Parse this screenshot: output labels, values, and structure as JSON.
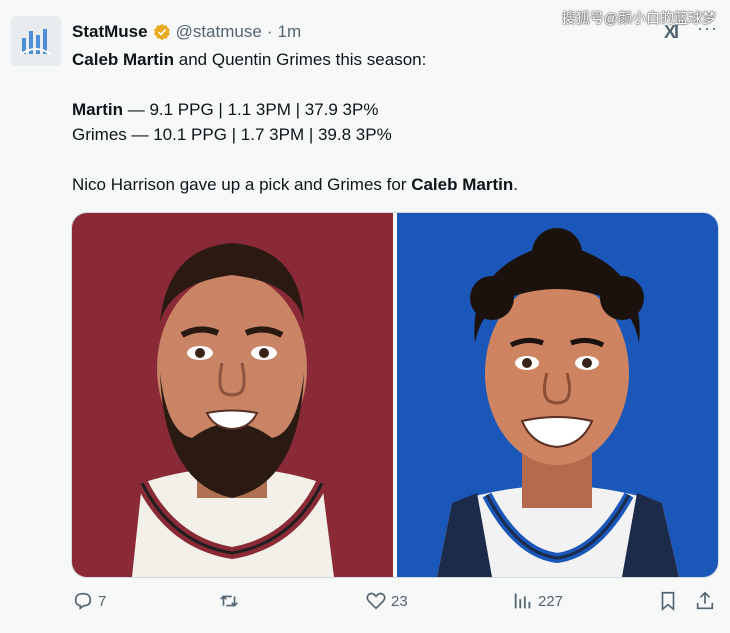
{
  "tweet": {
    "display_name": "StatMuse",
    "handle": "@statmuse",
    "separator": "·",
    "time": "1m",
    "lines": {
      "line1_bold": "Caleb Martin",
      "line1_rest": " and Quentin Grimes this season:",
      "martin_label": "Martin",
      "martin_stats": " — 9.1 PPG | 1.1 3PM | 37.9 3P%",
      "grimes_stats": "Grimes — 10.1 PPG | 1.7 3PM | 39.8 3P%",
      "line4_rest": "Nico Harrison gave up a pick and Grimes for ",
      "line4_bold": "Caleb Martin",
      "line4_end": "."
    }
  },
  "watermark": "搜狐号@颜小白的篮球梦",
  "grok_label": "XI",
  "more_label": "···",
  "actions": {
    "replies": "7",
    "likes": "23",
    "views": "227"
  },
  "colors": {
    "left_panel": "#8a2a37",
    "right_panel": "#1a57b8",
    "verified": "#e8a91c",
    "text_secondary": "#536471"
  },
  "icons": {
    "reply": "reply-icon",
    "retweet": "retweet-icon",
    "like": "heart-icon",
    "views": "views-icon",
    "bookmark": "bookmark-icon",
    "share": "share-icon"
  }
}
